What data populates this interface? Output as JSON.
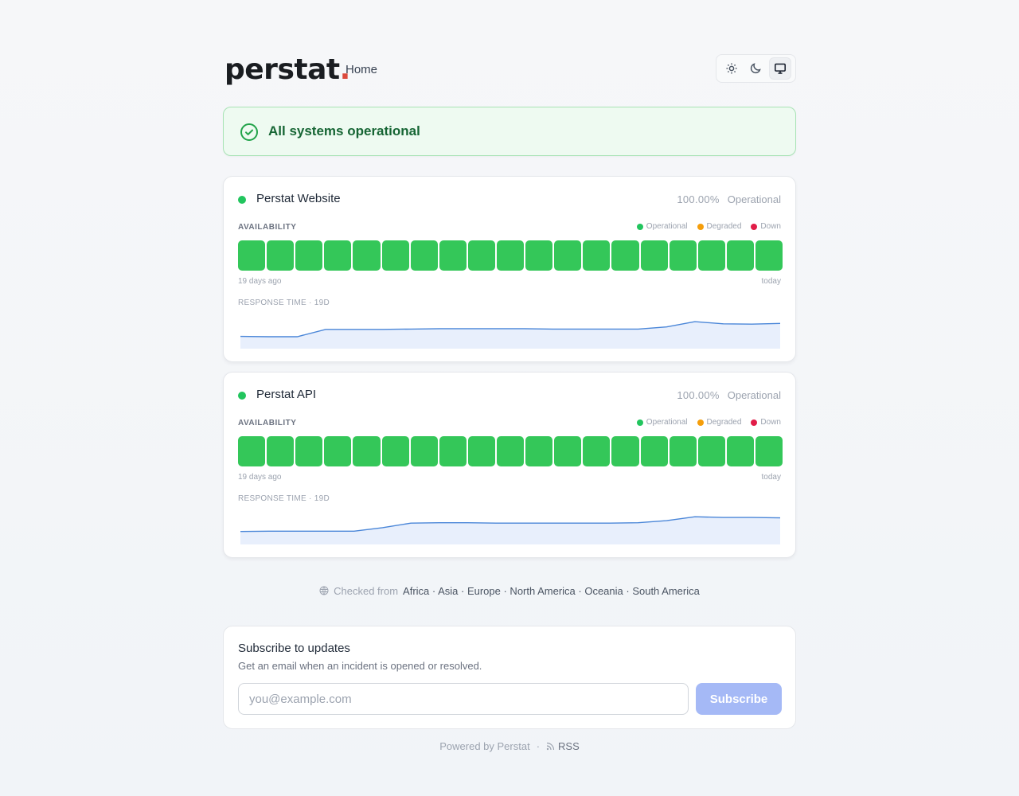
{
  "header": {
    "logo_text": "perstat",
    "logo_dot": ".",
    "nav_home": "Home",
    "theme_options": [
      "light",
      "dark",
      "system"
    ],
    "theme_selected": "system"
  },
  "banner": {
    "status_text": "All systems operational",
    "color": "#166534"
  },
  "legend": {
    "operational": "Operational",
    "degraded": "Degraded",
    "down": "Down",
    "colors": {
      "operational": "#22c55e",
      "degraded": "#f59e0b",
      "down": "#e11d48"
    }
  },
  "monitors": [
    {
      "name": "Perstat Website",
      "uptime": "100.00%",
      "status": "Operational",
      "availability_label": "AVAILABILITY",
      "days": [
        "operational",
        "operational",
        "operational",
        "operational",
        "operational",
        "operational",
        "operational",
        "operational",
        "operational",
        "operational",
        "operational",
        "operational",
        "operational",
        "operational",
        "operational",
        "operational",
        "operational",
        "operational",
        "operational"
      ],
      "range_start": "19 days ago",
      "range_end": "today",
      "response_time_label": "RESPONSE TIME · 19D",
      "response_series": [
        0.35,
        0.34,
        0.34,
        0.55,
        0.55,
        0.55,
        0.56,
        0.57,
        0.57,
        0.57,
        0.57,
        0.56,
        0.56,
        0.56,
        0.56,
        0.62,
        0.77,
        0.71,
        0.7,
        0.72
      ]
    },
    {
      "name": "Perstat API",
      "uptime": "100.00%",
      "status": "Operational",
      "availability_label": "AVAILABILITY",
      "days": [
        "operational",
        "operational",
        "operational",
        "operational",
        "operational",
        "operational",
        "operational",
        "operational",
        "operational",
        "operational",
        "operational",
        "operational",
        "operational",
        "operational",
        "operational",
        "operational",
        "operational",
        "operational",
        "operational"
      ],
      "range_start": "19 days ago",
      "range_end": "today",
      "response_time_label": "RESPONSE TIME · 19D",
      "response_series": [
        0.37,
        0.38,
        0.38,
        0.38,
        0.38,
        0.48,
        0.61,
        0.62,
        0.62,
        0.61,
        0.61,
        0.61,
        0.61,
        0.61,
        0.62,
        0.68,
        0.79,
        0.77,
        0.77,
        0.76
      ]
    }
  ],
  "regions": {
    "prefix": "Checked from",
    "list": "Africa · Asia · Europe · North America · Oceania · South America"
  },
  "subscribe": {
    "title": "Subscribe to updates",
    "description": "Get an email when an incident is opened or resolved.",
    "placeholder": "you@example.com",
    "value": "",
    "button_label": "Subscribe"
  },
  "footer": {
    "powered_by": "Powered by Perstat",
    "separator": "·",
    "rss_label": "RSS"
  }
}
